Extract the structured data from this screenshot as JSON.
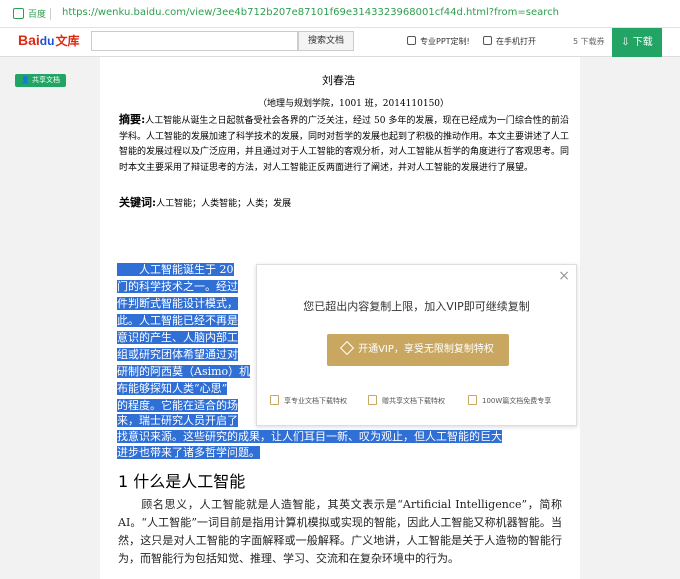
{
  "browser": {
    "badge_label": "百度",
    "url": "https://wenku.baidu.com/view/3ee4b712b207e87101f69e3143323968001cf44d.html?from=search"
  },
  "toolbar": {
    "logo_text": "Bai",
    "logo_paw": "du",
    "logo_suffix": "文库",
    "search_button": "搜索文档",
    "ppt_label": "专业PPT定制!",
    "mobile_label": "在手机打开",
    "download_count": "5 下载券",
    "download_button": "下载"
  },
  "document": {
    "share_badge": "共享文档",
    "author": "刘春浩",
    "affiliation": "（地理与规划学院，1001 班，2014110150）",
    "abstract_label": "摘要:",
    "abstract_text": "人工智能从诞生之日起就备受社会各界的广泛关注，经过 50 多年的发展，现在已经成为一门综合性的前沿学科。人工智能的发展加速了科学技术的发展，同时对哲学的发展也起到了积极的推动作用。本文主要讲述了人工智能的发展过程以及广泛应用，并且通过对于人工智能的客观分析，对人工智能从哲学的角度进行了客观思考。同时本文主要采用了辩证思考的方法，对人工智能正反两面进行了阐述，并对人工智能的发展进行了展望。",
    "keywords_label": "关键词:",
    "keywords_text": "人工智能；人类智能；人类；发展",
    "selected_lines": [
      "　　人工智能诞生于 20",
      "门的科学技术之一。经过",
      "件判断式智能设计模式，",
      "此。人工智能已经不再是",
      "意识的产生、人脑内部工",
      "组或研究团体希望通过对",
      "研制的阿西莫（Asimo）机",
      "布能够探知人类“心思”",
      "的程度。它能在适合的场",
      "来，瑞士研究人员开启了",
      "找意识来源。这些研究的成果，让人们耳目一新、叹为观止，但人工智能的巨大",
      "进步也带来了诸多哲学问题。"
    ],
    "heading": "1 什么是人工智能",
    "paragraph": "　　顾名思义，人工智能就是人造智能，其英文表示是“Artificial Intelligence”，简称AI。“人工智能”一词目前是指用计算机模拟或实现的智能，因此人工智能又称机器智能。当然，这只是对人工智能的字面解释或一般解释。广义地讲，人工智能是关于人造物的智能行为，而智能行为包括知觉、推理、学习、交流和在复杂环境中的行为。"
  },
  "modal": {
    "close": "×",
    "message": "您已超出内容复制上限，加入VIP即可继续复制",
    "vip_button": "开通VIP，享受无限制复制特权",
    "benefits": [
      "享专业文档下载特权",
      "赠共享文档下载特权",
      "100W篇文档免费专享"
    ]
  },
  "colors": {
    "accent_green": "#22a465",
    "vip_gold": "#c9a761",
    "selection_blue": "#2f6fd6",
    "brand_red": "#de2910"
  }
}
